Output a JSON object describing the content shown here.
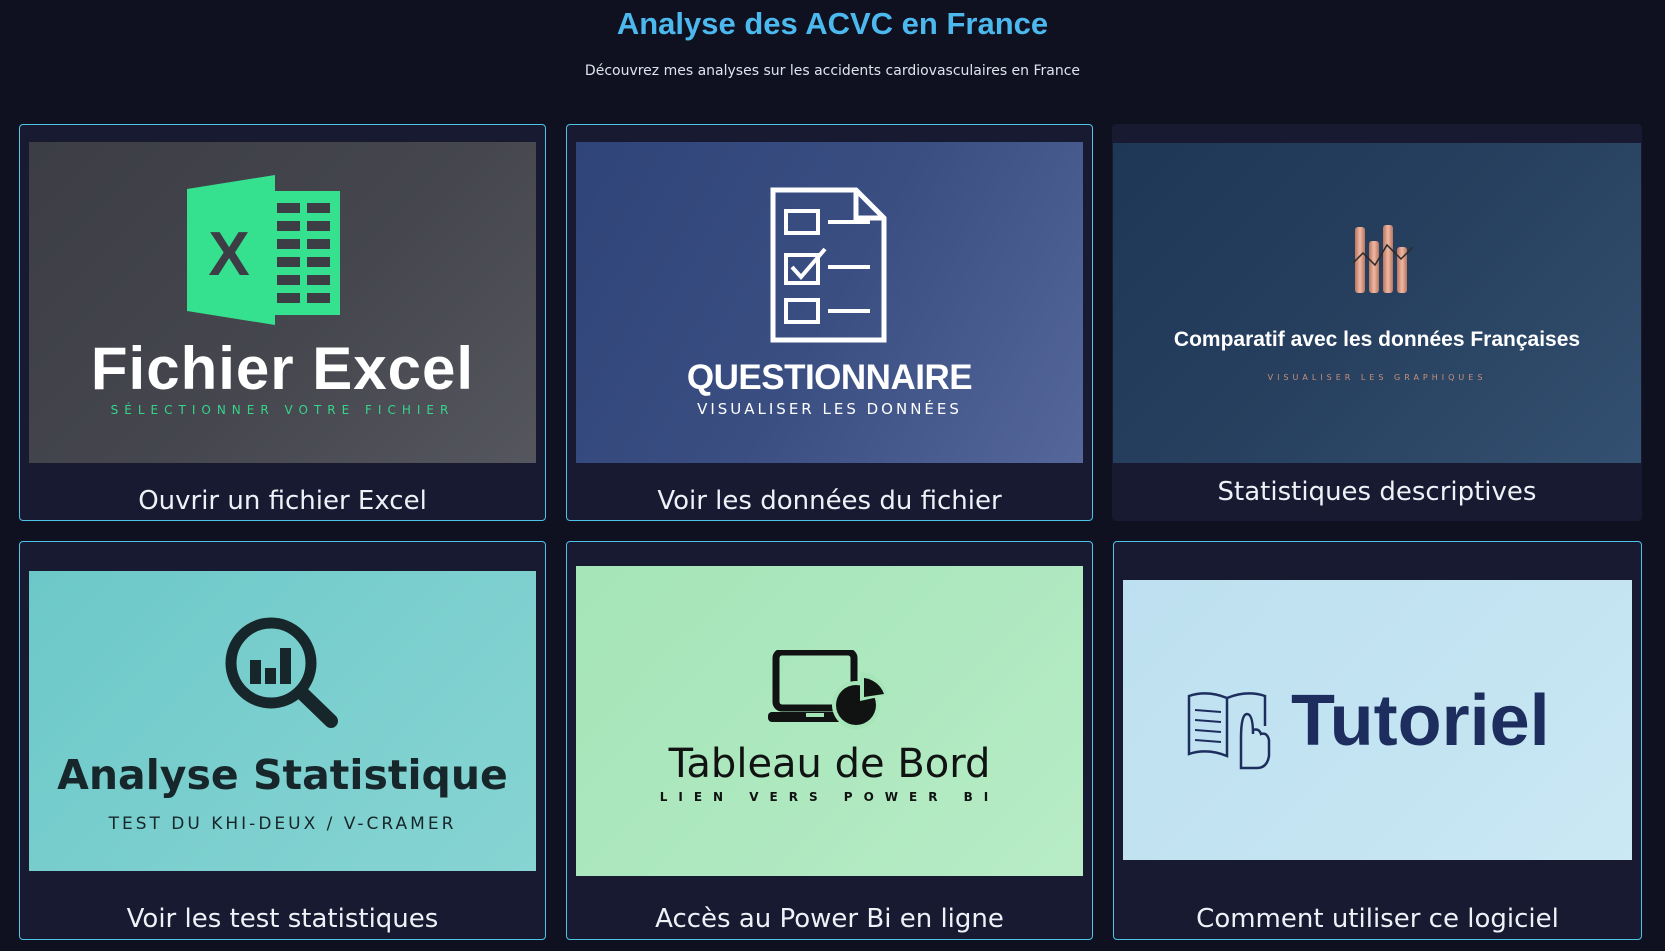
{
  "header": {
    "title": "Analyse des ACVC en France",
    "subtitle": "Découvrez mes analyses sur les accidents cardiovasculaires en France"
  },
  "cards": [
    {
      "caption": "Ouvrir un fichier Excel",
      "thumb_title": "Fichier Excel",
      "thumb_subtitle": "SÉLECTIONNER VOTRE FICHIER",
      "icon": "excel-icon",
      "icon_letter": "X",
      "accent": "#35e08f"
    },
    {
      "caption": "Voir les données du fichier",
      "thumb_title": "QUESTIONNAIRE",
      "thumb_subtitle": "VISUALISER LES DONNÉES",
      "icon": "checklist-icon"
    },
    {
      "caption": "Statistiques descriptives",
      "thumb_title": "Comparatif avec les données Françaises",
      "thumb_subtitle": "VISUALISER LES GRAPHIQUES",
      "icon": "bar-chart-icon",
      "accent": "#c98f78"
    },
    {
      "caption": "Voir les test statistiques",
      "thumb_title": "Analyse Statistique",
      "thumb_subtitle": "TEST DU KHI-DEUX / V-CRAMER",
      "icon": "magnifier-chart-icon"
    },
    {
      "caption": "Accès au Power Bi en ligne",
      "thumb_title": "Tableau de Bord",
      "thumb_subtitle": "LIEN VERS POWER BI",
      "icon": "laptop-pie-icon"
    },
    {
      "caption": "Comment utiliser ce logiciel",
      "thumb_title": "Tutoriel",
      "icon": "book-hand-icon",
      "accent": "#1d2e5e"
    }
  ]
}
